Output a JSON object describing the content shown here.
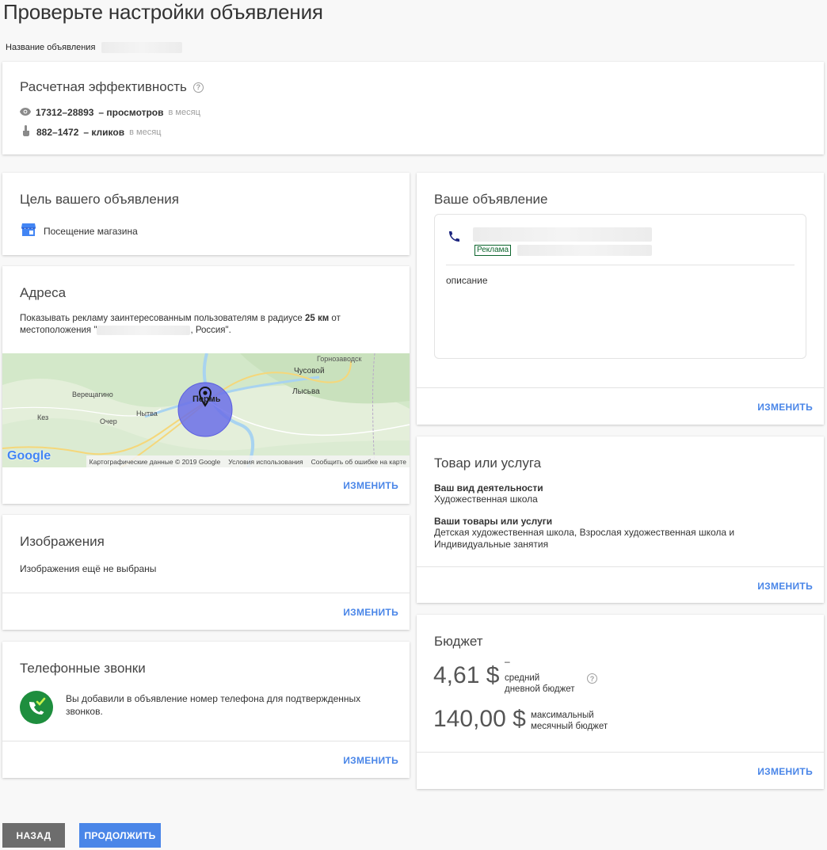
{
  "page": {
    "title": "Проверьте настройки объявления",
    "ad_name_label": "Название объявления"
  },
  "performance": {
    "title": "Расчетная эффективность",
    "views": {
      "range": "17312–28893",
      "label": "– просмотров",
      "period": "в месяц"
    },
    "clicks": {
      "range": "882–1472",
      "label": "– кликов",
      "period": "в месяц"
    }
  },
  "goal": {
    "title": "Цель вашего объявления",
    "value": "Посещение магазина"
  },
  "addresses": {
    "title": "Адреса",
    "text_before": "Показывать рекламу заинтересованным пользователям в радиусе ",
    "radius": "25 км",
    "text_after": " от",
    "location_prefix": "местоположения \"",
    "location_suffix": ", Россия\".",
    "change_label": "ИЗМЕНИТЬ",
    "map": {
      "city": "Пермь",
      "places": [
        "Горнозаводск",
        "Чусовой",
        "Лысьва",
        "Верещагино",
        "Кез",
        "Очер",
        "Нытва"
      ],
      "google_logo": "Google",
      "footer_data": "Картографические данные © 2019 Google",
      "footer_terms": "Условия использования",
      "footer_report": "Сообщить об ошибке на карте"
    }
  },
  "images": {
    "title": "Изображения",
    "text": "Изображения ещё не выбраны",
    "change_label": "ИЗМЕНИТЬ"
  },
  "calls": {
    "title": "Телефонные звонки",
    "text": "Вы добавили в объявление номер телефона для подтвержденных звонков.",
    "change_label": "ИЗМЕНИТЬ"
  },
  "your_ad": {
    "title": "Ваше объявление",
    "badge": "Реклама",
    "description": "описание",
    "change_label": "ИЗМЕНИТЬ"
  },
  "product": {
    "title": "Товар или услуга",
    "activity_label": "Ваш вид деятельности",
    "activity_value": "Художественная школа",
    "goods_label": "Ваши товары или услуги",
    "goods_value": "Детская художественная школа, Взрослая художественная школа и Индивидуальные занятия",
    "change_label": "ИЗМЕНИТЬ"
  },
  "budget": {
    "title": "Бюджет",
    "daily_amount": "4,61 $",
    "daily_dash": "–",
    "daily_label_1": "средний",
    "daily_label_2": "дневной бюджет",
    "monthly_amount": "140,00 $",
    "monthly_label_1": "максимальный",
    "monthly_label_2": "месячный бюджет",
    "change_label": "ИЗМЕНИТЬ"
  },
  "footer": {
    "back_label": "НАЗАД",
    "continue_label": "ПРОДОЛЖИТЬ"
  },
  "colors": {
    "accent": "#4a86e8",
    "back_button": "#6d6d6d",
    "continue_button": "#4a86e8",
    "map_circle": "#6b6ee8",
    "phone_icon": "#1a237e",
    "call_icon_bg": "#2e7d32",
    "badge_green": "#0d652d"
  }
}
